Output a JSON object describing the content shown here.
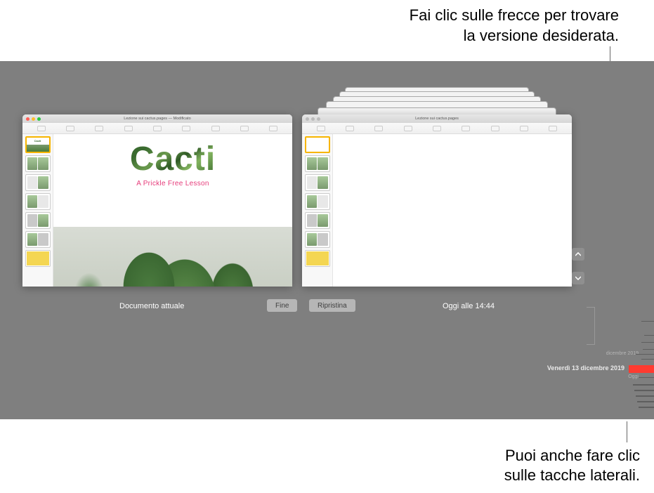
{
  "callouts": {
    "top_line1": "Fai clic sulle frecce per trovare",
    "top_line2": "la versione desiderata.",
    "bottom_line1": "Puoi anche fare clic",
    "bottom_line2": "sulle tacche laterali."
  },
  "left_window": {
    "title": "Lezione sui cactus.pages — Modificato",
    "slide_title": "Cacti",
    "slide_subtitle": "A Prickle Free Lesson",
    "label_below": "Documento attuale",
    "done_button": "Fine"
  },
  "right_window": {
    "title": "Lezione sui cactus.pages",
    "restore_button": "Ripristina",
    "version_timestamp": "Oggi alle  14:44"
  },
  "timeline": {
    "month_label": "dicembre 2019",
    "selected_label": "Venerdì 13 dicembre 2019",
    "today_label": "Oggi"
  }
}
